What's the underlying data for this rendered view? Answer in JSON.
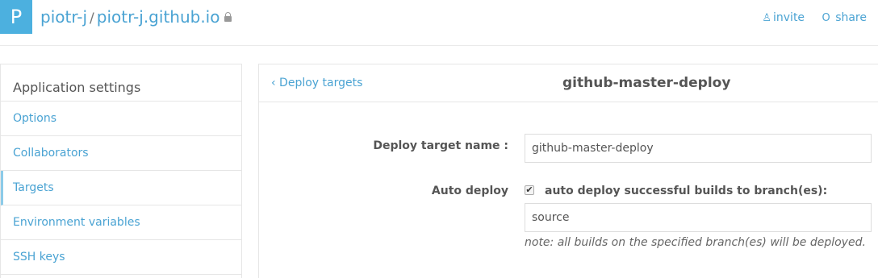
{
  "header": {
    "avatar_letter": "P",
    "owner": "piotr-j",
    "separator": "/",
    "repo": "piotr-j.github.io",
    "invite_label": "invite",
    "share_label": "share",
    "invite_icon": "add-user-icon",
    "share_icon": "share-icon"
  },
  "sidebar": {
    "title": "Application settings",
    "items": [
      {
        "label": "Options"
      },
      {
        "label": "Collaborators"
      },
      {
        "label": "Targets"
      },
      {
        "label": "Environment variables"
      },
      {
        "label": "SSH keys"
      }
    ],
    "active_item": "Targets"
  },
  "panel": {
    "back_label": "‹ Deploy targets",
    "title": "github-master-deploy",
    "form": {
      "name_label": "Deploy target name :",
      "name_value": "github-master-deploy",
      "auto_deploy_label": "Auto deploy",
      "auto_deploy_checked": true,
      "auto_deploy_text": "auto deploy successful builds to branch(es):",
      "branch_value": "source",
      "note": "note: all builds on the specified branch(es) will be deployed."
    }
  },
  "colors": {
    "accent": "#4aa3d3",
    "avatar_bg": "#4cb0df",
    "active_indicator": "#8ccbe9"
  }
}
